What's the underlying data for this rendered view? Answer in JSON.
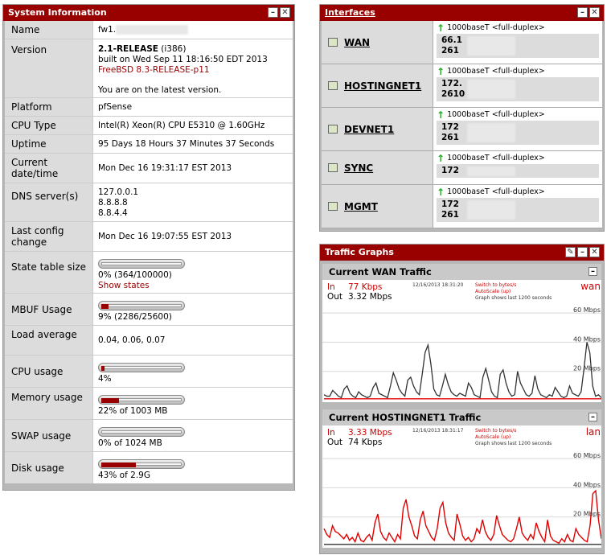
{
  "system_info": {
    "title": "System Information",
    "rows": {
      "name": {
        "label": "Name",
        "value": "fw1."
      },
      "version": {
        "label": "Version",
        "release": "2.1-RELEASE",
        "arch": "(i386)",
        "built": "built on Wed Sep 11 18:16:50 EDT 2013",
        "freebsd": "FreeBSD 8.3-RELEASE-p11",
        "status": "You are on the latest version."
      },
      "platform": {
        "label": "Platform",
        "value": "pfSense"
      },
      "cpu_type": {
        "label": "CPU Type",
        "value": "Intel(R) Xeon(R) CPU E5310 @ 1.60GHz"
      },
      "uptime": {
        "label": "Uptime",
        "value": "95 Days 18 Hours 37 Minutes 37 Seconds"
      },
      "current_datetime": {
        "label": "Current date/time",
        "value": "Mon Dec 16 19:31:17 EST 2013"
      },
      "dns": {
        "label": "DNS server(s)",
        "servers": [
          "127.0.0.1",
          "8.8.8.8",
          "8.8.4.4"
        ]
      },
      "last_config": {
        "label": "Last config change",
        "value": "Mon Dec 16 19:07:55 EST 2013"
      },
      "state_table": {
        "label": "State table size",
        "value": "0% (364/100000)",
        "link": "Show states",
        "percent": 0
      },
      "mbuf": {
        "label": "MBUF Usage",
        "value": "9% (2286/25600)",
        "percent": 9
      },
      "load": {
        "label": "Load average",
        "value": "0.04, 0.06, 0.07"
      },
      "cpu_usage": {
        "label": "CPU usage",
        "value": "4%",
        "percent": 4
      },
      "memory": {
        "label": "Memory usage",
        "value": "22% of 1003 MB",
        "percent": 22
      },
      "swap": {
        "label": "SWAP usage",
        "value": "0% of 1024 MB",
        "percent": 0
      },
      "disk": {
        "label": "Disk usage",
        "value": "43% of 2.9G",
        "percent": 43
      }
    }
  },
  "interfaces": {
    "title": "Interfaces",
    "items": [
      {
        "name": "WAN",
        "media": "1000baseT <full-duplex>",
        "ip1": "66.1",
        "ip2": "261"
      },
      {
        "name": "HOSTINGNET1",
        "media": "1000baseT <full-duplex>",
        "ip1": "172.",
        "ip2": "2610"
      },
      {
        "name": "DEVNET1",
        "media": "1000baseT <full-duplex>",
        "ip1": "172",
        "ip2": "261"
      },
      {
        "name": "SYNC",
        "media": "1000baseT <full-duplex>",
        "ip1": "172",
        "ip2": ""
      },
      {
        "name": "MGMT",
        "media": "1000baseT <full-duplex>",
        "ip1": "172",
        "ip2": "261"
      }
    ]
  },
  "traffic_graphs": {
    "title": "Traffic Graphs",
    "graphs": [
      {
        "title": "Current WAN Traffic",
        "iface": "wan",
        "in_label": "In",
        "in_value": "77 Kbps",
        "out_label": "Out",
        "out_value": "3.32 Mbps",
        "timestamp": "12/16/2013 18:31:20",
        "link_bytes": "Switch to bytes/s",
        "link_autoscale": "AutoScale (up)",
        "note": "Graph shows last 1200 seconds",
        "y_ticks": [
          "60 Mbps",
          "40 Mbps",
          "20 Mbps"
        ]
      },
      {
        "title": "Current HOSTINGNET1 Traffic",
        "iface": "lan",
        "in_label": "In",
        "in_value": "3.33 Mbps",
        "out_label": "Out",
        "out_value": "74 Kbps",
        "timestamp": "12/16/2013 18:31:17",
        "link_bytes": "Switch to bytes/s",
        "link_autoscale": "AutoScale (up)",
        "note": "Graph shows last 1200 seconds",
        "y_ticks": [
          "60 Mbps",
          "40 Mbps",
          "20 Mbps"
        ]
      }
    ]
  },
  "colors": {
    "title_bar": "#990000",
    "in_line": "#e00000",
    "out_line": "#333333",
    "in_text": "#cc0000"
  }
}
